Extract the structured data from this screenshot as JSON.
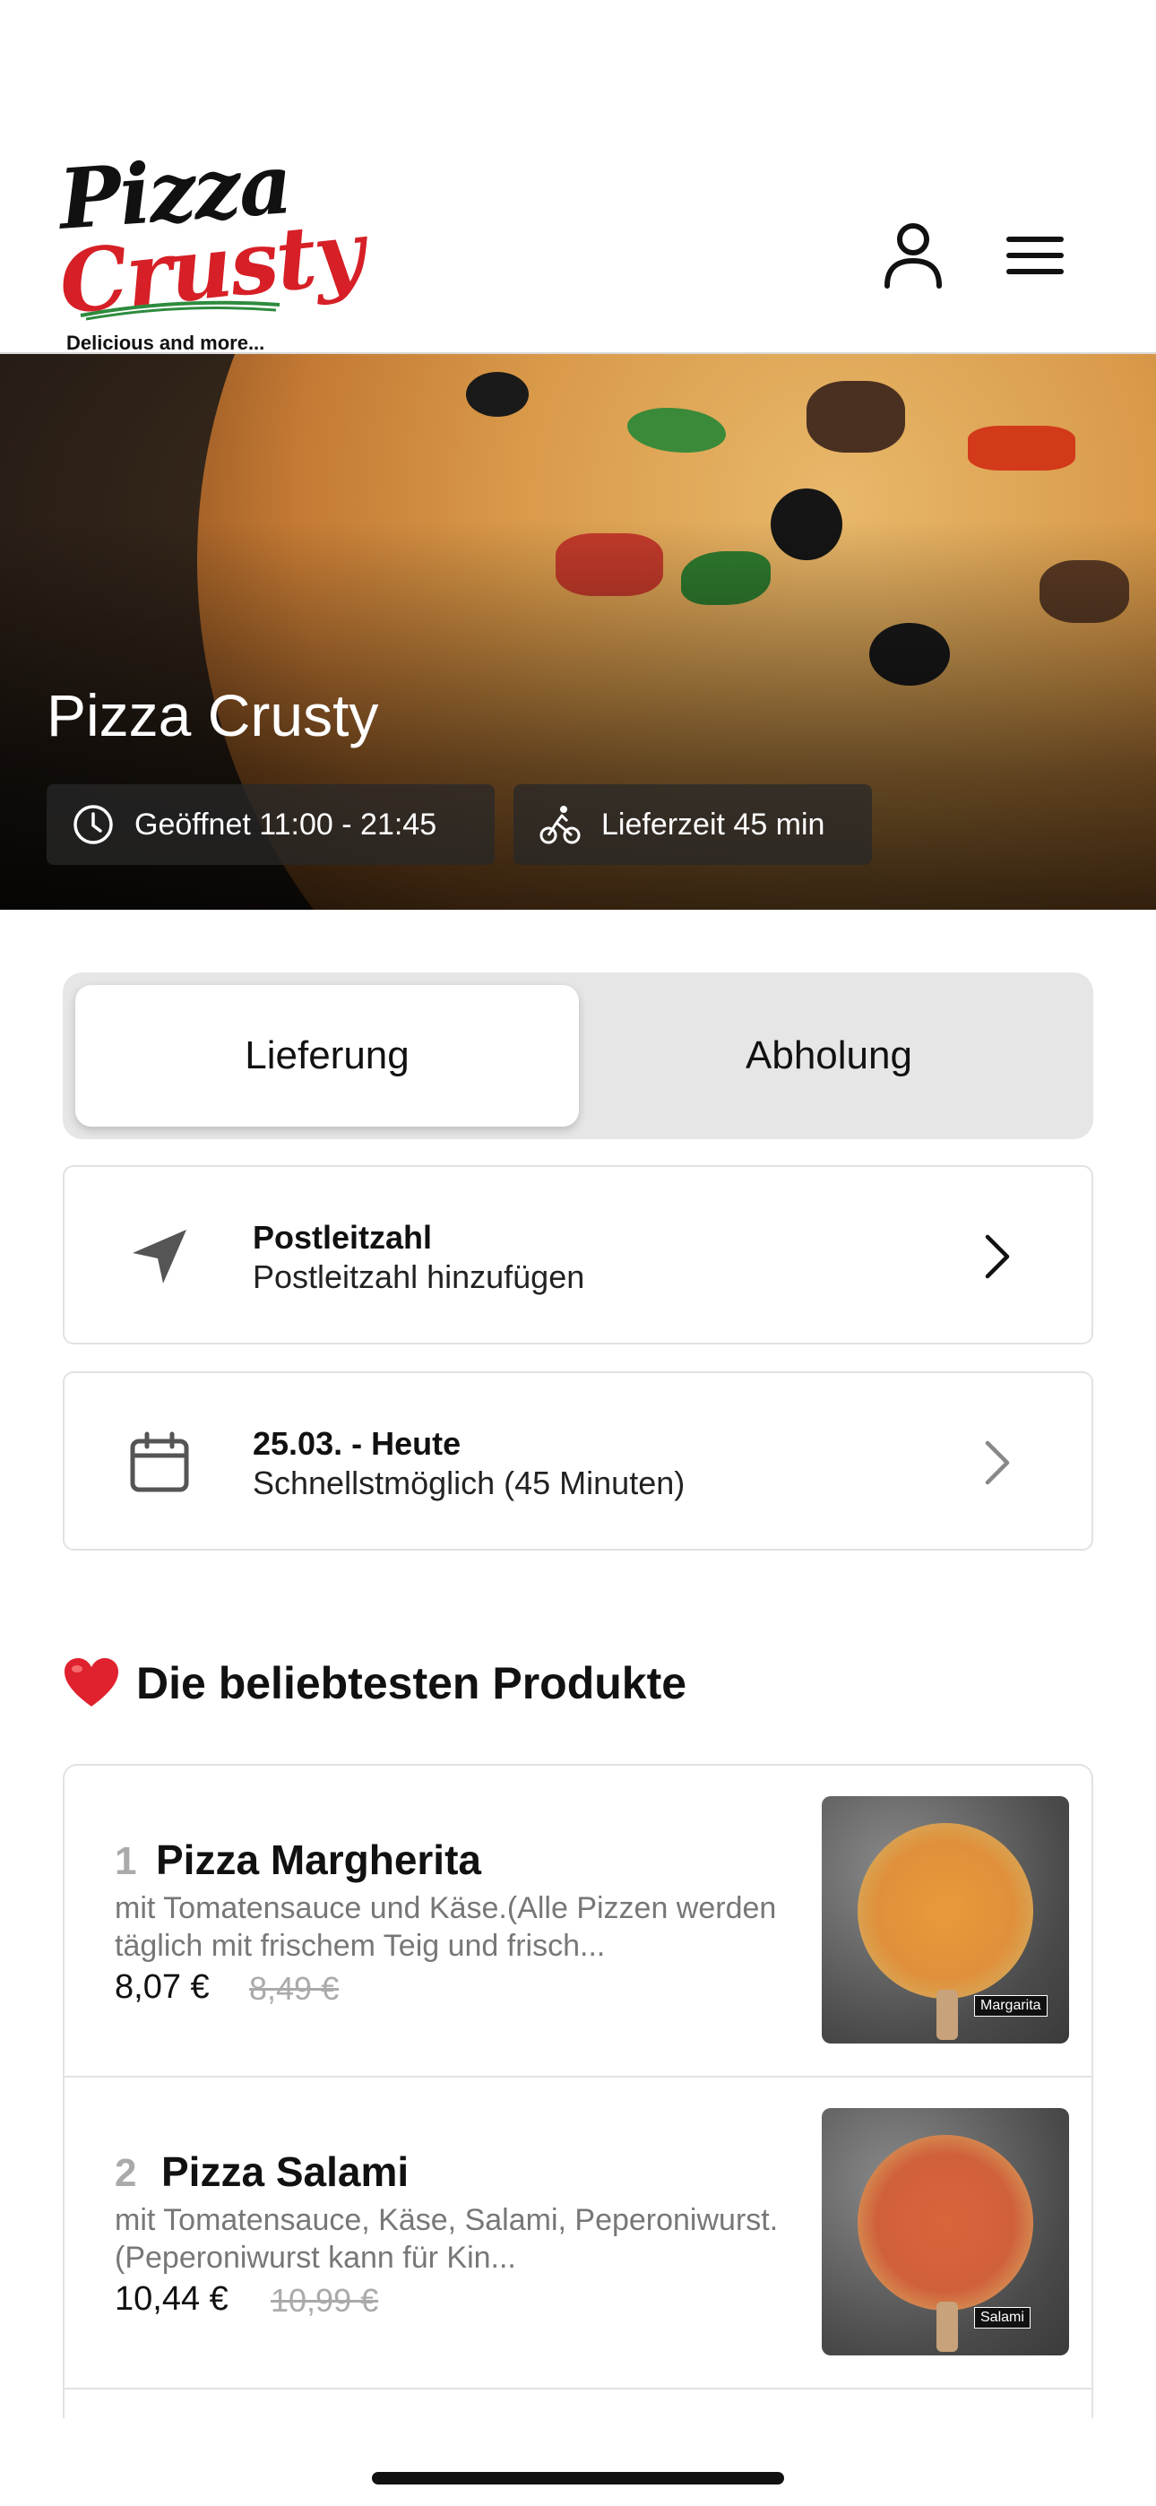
{
  "header": {
    "logo_line1": "Pizza",
    "logo_line2": "Crusty",
    "logo_tagline": "Delicious and more...",
    "user_icon": "user-icon",
    "menu_icon": "hamburger-menu-icon"
  },
  "hero": {
    "title": "Pizza Crusty",
    "open_label": "Geöffnet 11:00 - 21:45",
    "delivery_label": "Lieferzeit 45 min"
  },
  "mode": {
    "delivery": "Lieferung",
    "pickup": "Abholung",
    "selected": "Lieferung"
  },
  "postcode": {
    "title": "Postleitzahl",
    "subtitle": "Postleitzahl hinzufügen"
  },
  "schedule": {
    "title": "25.03. - Heute",
    "subtitle": "Schnellstmöglich (45 Minuten)"
  },
  "popular": {
    "heading": "Die beliebtesten Produkte",
    "heart": "❤️",
    "items": [
      {
        "rank": "1",
        "name": "Pizza Margherita",
        "description": "mit Tomatensauce und Käse.(Alle Pizzen werden täglich mit frischem Teig und frisch...",
        "price": "8,07 €",
        "old_price": "8,49 €",
        "image_label": "Margarita"
      },
      {
        "rank": "2",
        "name": "Pizza Salami",
        "description": "mit Tomatensauce, Käse, Salami, Peperoniwurst.(Peperoniwurst kann für Kin...",
        "price": "10,44 €",
        "old_price": "10,99 €",
        "image_label": "Salami"
      }
    ]
  },
  "colors": {
    "brand_red": "#d61f26",
    "segment_bg": "#e6e6e6",
    "border": "#e2e2e2"
  }
}
